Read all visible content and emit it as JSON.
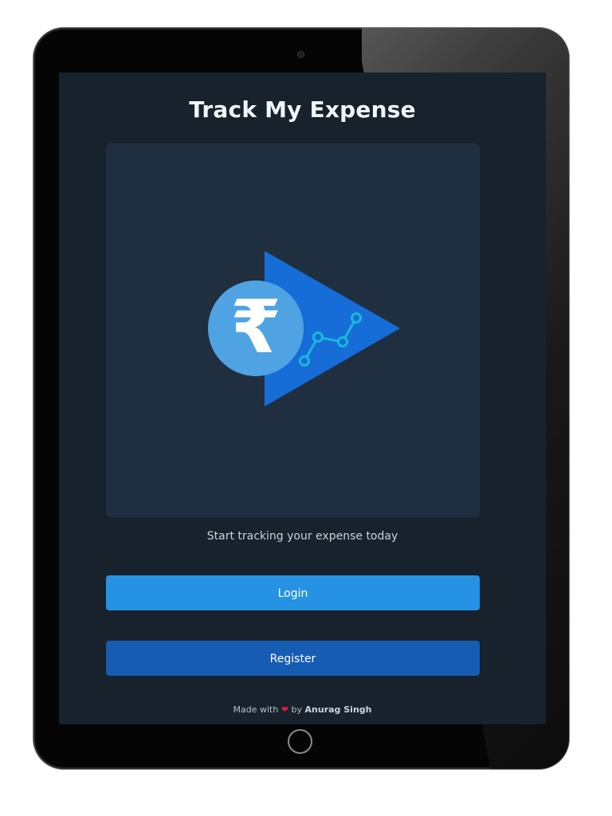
{
  "app": {
    "title": "Track My Expense",
    "tagline": "Start tracking your expense today"
  },
  "hero": {
    "logo_symbol": "₹",
    "logo_icon": "rupee-growth-logo",
    "colors": {
      "triangle": "#166dd8",
      "circle": "#4fa3e3",
      "graph": "#19b8d8"
    }
  },
  "actions": {
    "login_label": "Login",
    "register_label": "Register"
  },
  "footer": {
    "prefix": "Made with",
    "heart": "❤",
    "by": "by",
    "author": "Anurag Singh"
  },
  "colors": {
    "screen_bg": "#17222c",
    "card_bg": "#202f40",
    "login": "#2592e3",
    "register": "#165cb3"
  }
}
